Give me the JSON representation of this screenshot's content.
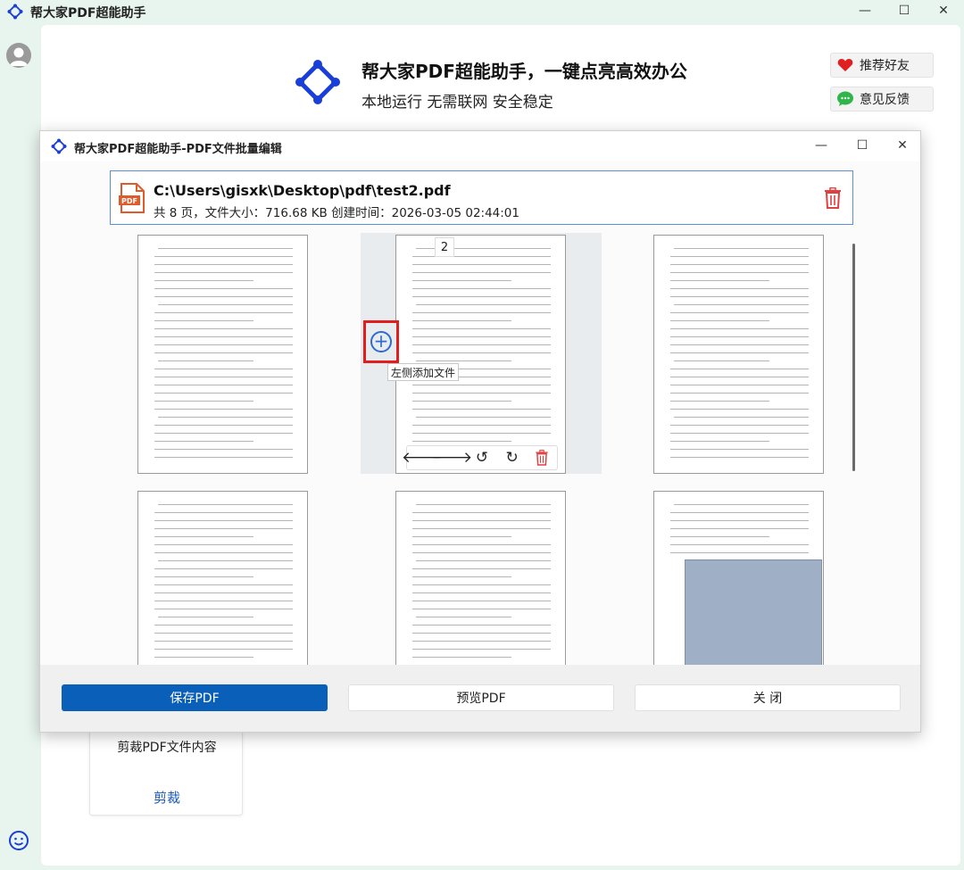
{
  "app": {
    "title": "帮大家PDF超能助手",
    "minimize": "—",
    "maximize": "☐",
    "close": "✕"
  },
  "hero": {
    "title": "帮大家PDF超能助手，一键点亮高效办公",
    "subtitle": "本地运行 无需联网 安全稳定"
  },
  "side_buttons": {
    "recommend": "推荐好友",
    "feedback": "意见反馈"
  },
  "crop_card": {
    "label": "剪裁PDF文件内容",
    "link": "剪裁"
  },
  "dialog": {
    "title": "帮大家PDF超能助手-PDF文件批量编辑",
    "minimize": "—",
    "maximize": "☐",
    "close": "✕",
    "file": {
      "path": "C:\\Users\\gisxk\\Desktop\\pdf\\test2.pdf",
      "meta": "共 8 页，文件大小：716.68 KB 创建时间：2026-03-05 02:44:01",
      "icon_label": "PDF"
    },
    "page_number": "2",
    "tooltip": "左侧添加文件",
    "footer": {
      "save": "保存PDF",
      "preview": "预览PDF",
      "close": "关 闭"
    }
  },
  "colors": {
    "accent": "#0a5fb8",
    "logo_blue": "#1a3fd8",
    "highlight_red": "#e01e1e",
    "delete_red": "#e04040"
  }
}
